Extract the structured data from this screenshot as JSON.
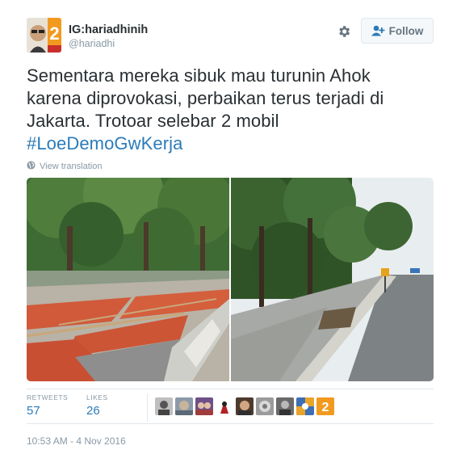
{
  "user": {
    "display_name": "IG:hariadhinih",
    "handle": "@hariadhi",
    "avatar_badge": "2"
  },
  "actions": {
    "follow_label": "Follow",
    "settings_icon": "gear-icon",
    "follow_icon": "add-user-icon"
  },
  "tweet": {
    "lines": [
      "Sementara mereka sibuk mau turunin Ahok",
      "karena diprovokasi, perbaikan terus terjadi di",
      "Jakarta. Trotoar selebar 2 mobil"
    ],
    "hashtag": "#LoeDemoGwKerja",
    "translate_label": "View translation"
  },
  "stats": {
    "retweets_label": "RETWEETS",
    "retweets": "57",
    "likes_label": "LIKES",
    "likes": "26"
  },
  "timestamp": "10:53 AM - 4 Nov 2016",
  "colors": {
    "link": "#2b7bb9",
    "muted": "#8899a6",
    "text": "#292f33",
    "border": "#e1e8ed"
  }
}
